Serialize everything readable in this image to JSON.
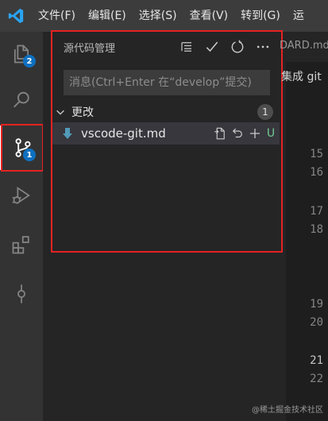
{
  "menubar": {
    "items": [
      "文件(F)",
      "编辑(E)",
      "选择(S)",
      "查看(V)",
      "转到(G)",
      "运"
    ]
  },
  "activity_bar": {
    "items": [
      {
        "name": "explorer",
        "icon": "files-icon",
        "badge": "2"
      },
      {
        "name": "search",
        "icon": "search-icon",
        "badge": null
      },
      {
        "name": "source-control",
        "icon": "source-control-icon",
        "badge": "1"
      },
      {
        "name": "run-debug",
        "icon": "run-debug-icon",
        "badge": null
      },
      {
        "name": "extensions",
        "icon": "extensions-icon",
        "badge": null
      },
      {
        "name": "git-commit",
        "icon": "git-commit-icon",
        "badge": null
      }
    ]
  },
  "scm": {
    "title": "源代码管理",
    "actions": [
      "view-as-tree-icon",
      "check-icon",
      "refresh-icon",
      "more-icon"
    ],
    "message_placeholder": "消息(Ctrl+Enter 在“develop”提交)",
    "message_value": "",
    "section": {
      "label": "更改",
      "count": "1",
      "files": [
        {
          "name": "vscode-git.md",
          "status": "U"
        }
      ]
    }
  },
  "editor": {
    "tab_text": "DARD.md",
    "text_fragment": "集成 git",
    "line_numbers": [
      "15",
      "16",
      "17",
      "18",
      "19",
      "20",
      "21",
      "22"
    ],
    "current_line": "21"
  },
  "watermark": "@稀土掘金技术社区",
  "colors": {
    "accent": "#0e70c0",
    "highlight_border": "#e52222",
    "untracked": "#73c991"
  }
}
